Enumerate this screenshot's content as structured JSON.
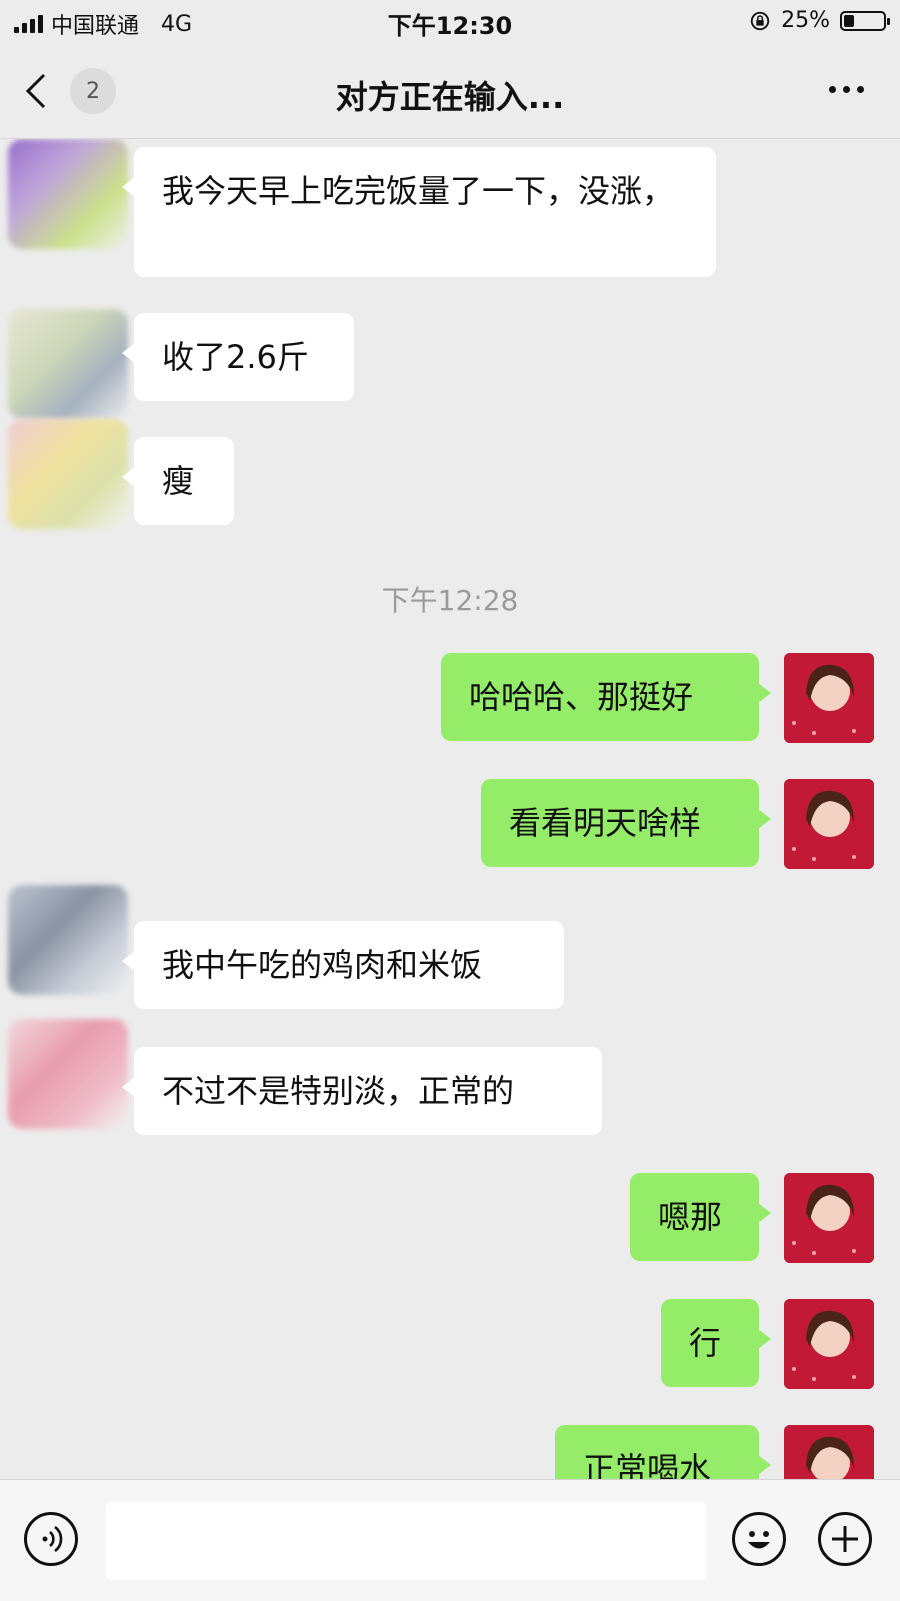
{
  "status_bar": {
    "carrier": "中国联通",
    "network": "4G",
    "time": "下午12:30",
    "battery_percent": "25%",
    "battery_level": 0.25
  },
  "nav": {
    "back_badge": "2",
    "title": "对方正在输入..."
  },
  "messages": [
    {
      "side": "in",
      "text": "我今天早上吃完饭量了一下，没涨，"
    },
    {
      "side": "in",
      "text": "收了2.6斤"
    },
    {
      "side": "in",
      "text": "瘦"
    },
    {
      "type": "timestamp",
      "text": "下午12:28"
    },
    {
      "side": "out",
      "text": "哈哈哈、那挺好"
    },
    {
      "side": "out",
      "text": "看看明天啥样"
    },
    {
      "side": "in",
      "text": "我中午吃的鸡肉和米饭"
    },
    {
      "side": "in",
      "text": "不过不是特别淡，正常的"
    },
    {
      "side": "out",
      "text": "嗯那"
    },
    {
      "side": "out",
      "text": "行"
    },
    {
      "side": "out",
      "text": "正常喝水"
    }
  ],
  "input_bar": {
    "voice_icon": "voice-icon",
    "emoji_icon": "emoji-icon",
    "plus_icon": "plus-icon",
    "text_value": ""
  },
  "colors": {
    "background": "#ececec",
    "bubble_in": "#ffffff",
    "bubble_out": "#95ec69",
    "timestamp": "#9a9a9a"
  }
}
